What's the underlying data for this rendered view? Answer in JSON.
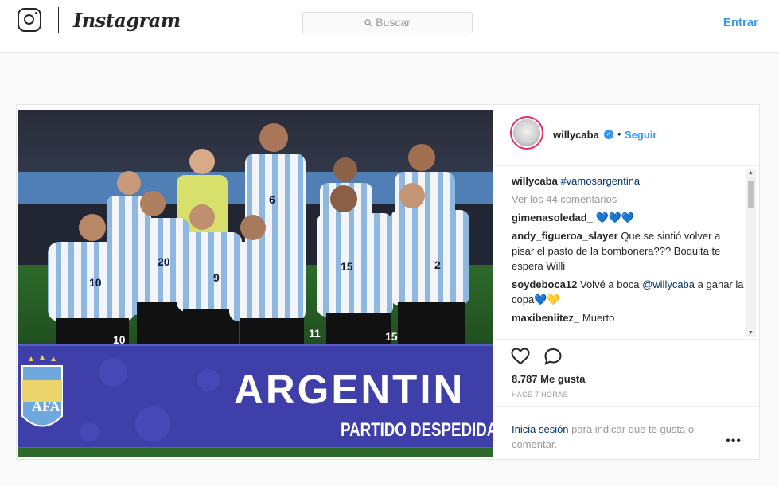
{
  "header": {
    "logo_text": "Instagram",
    "search_placeholder": "Buscar",
    "login_label": "Entrar"
  },
  "post": {
    "image": {
      "banner_text": "ARGENTIN",
      "banner_subtext": "PARTIDO DESPEDIDA",
      "crest_text": "AFA",
      "jersey_numbers": [
        "6",
        "10",
        "20",
        "9",
        "11",
        "15",
        "15",
        "2",
        "10"
      ]
    },
    "author": {
      "username": "willycaba",
      "follow_label": "Seguir",
      "separator": "•"
    },
    "caption": {
      "username": "willycaba",
      "text": "#vamosargentina"
    },
    "view_comments_label": "Ver los 44 comentarios",
    "comments": [
      {
        "username": "gimenasoledad_",
        "text": "💙💙💙"
      },
      {
        "username": "andy_figueroa_slayer",
        "text": "Que se sintió volver a pisar el pasto de la bombonera??? Boquita te espera Willi"
      },
      {
        "username": "soydeboca12",
        "text_before": "Volvé a boca",
        "mention": "@willycaba",
        "text_after": "a ganar la copa💙💛"
      },
      {
        "username": "maxibeniitez_",
        "text": "Muerto"
      }
    ],
    "likes_label": "8.787 Me gusta",
    "time_label": "HACE 7 HORAS",
    "login_prompt": {
      "link": "Inicia sesión",
      "text": "para indicar que te gusta o comentar."
    },
    "more_label": "•••"
  },
  "colors": {
    "accent_blue": "#3897f0",
    "text": "#262626",
    "muted": "#999999",
    "border": "#e6e6e6"
  }
}
